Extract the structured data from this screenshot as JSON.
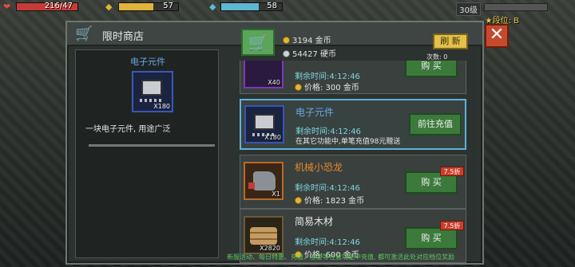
{
  "hud": {
    "hp_value": "216/47",
    "energy_value": "57",
    "shield_value": "58",
    "level": "30级",
    "rank": "★段位: B"
  },
  "shop": {
    "title": "限时商店",
    "gold": "3194 金币",
    "coins": "54427 硬币",
    "refresh_label": "刷 新",
    "refresh_count": "次数: 0",
    "close_label": "✕"
  },
  "detail": {
    "name": "电子元件",
    "quantity": "X180",
    "description": "一块电子元件, 用途广泛"
  },
  "items": [
    {
      "name": "",
      "quantity": "X40",
      "time": "剩余时间:4:12:46",
      "price": "价格: 300 金币",
      "button": "购 买",
      "discount": ""
    },
    {
      "name": "电子元件",
      "quantity": "X180",
      "time": "剩余时间:4:12:46",
      "price": "在其它功能中,单笔充值98元赠送",
      "button": "前往充值",
      "discount": ""
    },
    {
      "name": "机械小恐龙",
      "quantity": "X1",
      "time": "剩余时间:4:12:46",
      "price": "价格: 1823 金币",
      "button": "购 买",
      "discount": "7.5折"
    },
    {
      "name": "简易木材",
      "quantity": "X2820",
      "time": "剩余时间:4:12:46",
      "price": "价格: 600 金币",
      "button": "购 买",
      "discount": "7.5折"
    }
  ],
  "footer": "新服活动、每日特惠、充值、基金等任意功能中充值, 都可激活此处对应档位奖励",
  "colors": {
    "accent": "#5fb2d6",
    "gold": "#e6b72e",
    "buy": "#3c7a3c"
  }
}
